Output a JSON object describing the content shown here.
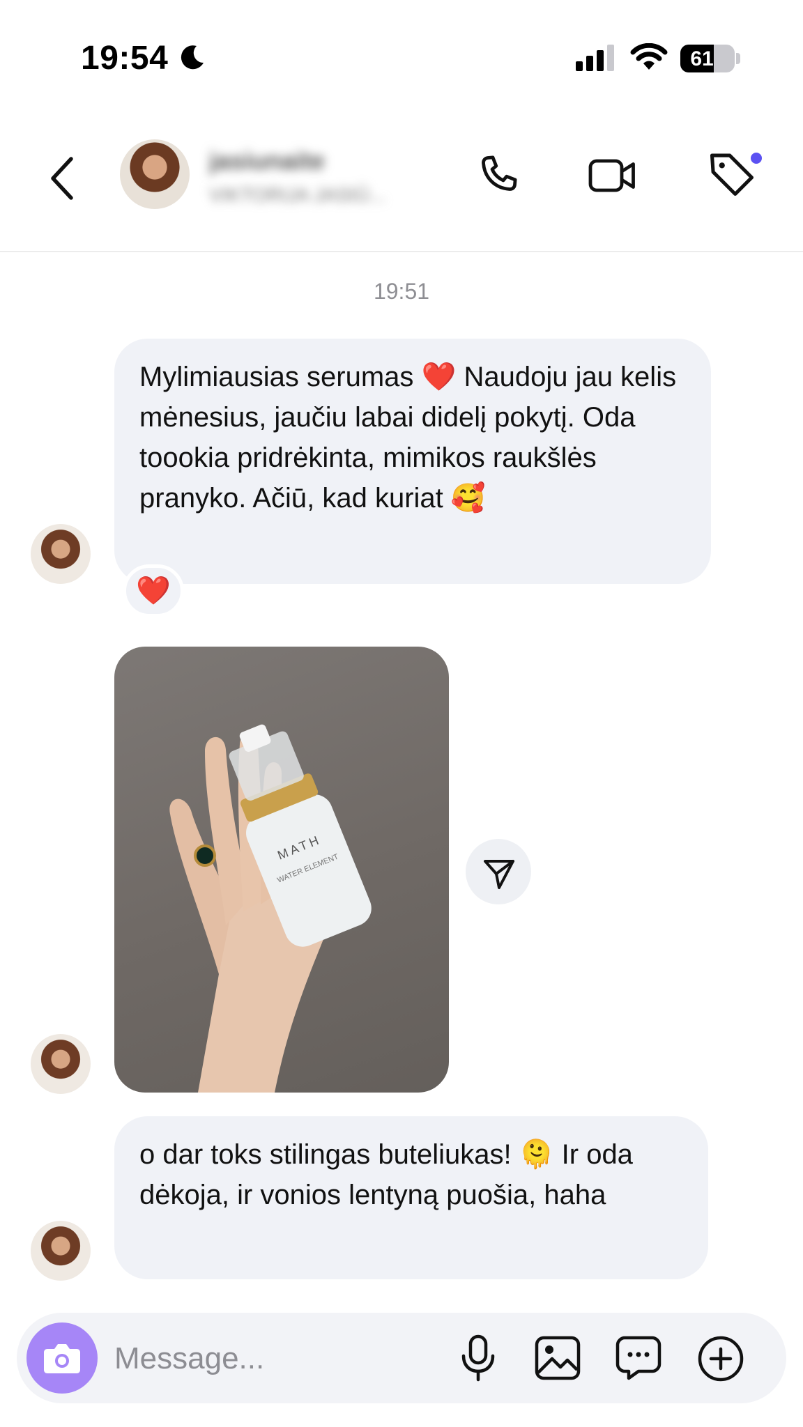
{
  "status_bar": {
    "time": "19:54",
    "battery": "61"
  },
  "header": {
    "contact_name": "jasiunaite",
    "contact_subtitle": "VIKTORIJA JASIŪ..."
  },
  "chat": {
    "timestamp": "19:51",
    "messages": [
      {
        "text": "Mylimiausias serumas ❤️ Naudoju jau kelis mėnesius, jaučiu labai didelį pokytį. Oda toookia pridrėkinta, mimikos raukšlės pranyko. Ačiū, kad kuriat 🥰",
        "reaction": "❤️"
      },
      {
        "text": "o dar toks stilingas buteliukas! 🫠 Ir oda dėkoja, ir vonios lentyną puošia, haha"
      }
    ],
    "photo": {
      "brand": "MATH",
      "product": "WATER ELEMENT"
    }
  },
  "composer": {
    "placeholder": "Message..."
  }
}
